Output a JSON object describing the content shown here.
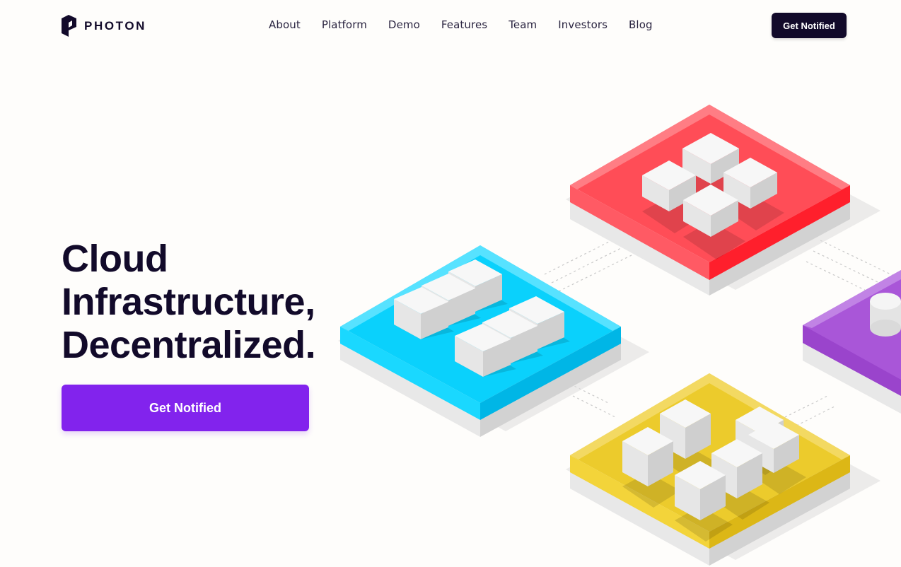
{
  "brand": {
    "name": "PHOTON",
    "icon": "photon-logo-icon"
  },
  "nav": {
    "items": [
      {
        "label": "About"
      },
      {
        "label": "Platform"
      },
      {
        "label": "Demo"
      },
      {
        "label": "Features"
      },
      {
        "label": "Team"
      },
      {
        "label": "Investors"
      },
      {
        "label": "Blog"
      }
    ],
    "cta_label": "Get Notified"
  },
  "hero": {
    "headline_lines": [
      "Cloud",
      "Infrastructure,",
      "Decentralized."
    ],
    "cta_label": "Get Notified"
  },
  "colors": {
    "ink": "#120a2a",
    "accent": "#8223ed",
    "tile_red": "#ff4d57",
    "tile_blue": "#0ad1fc",
    "tile_yellow": "#eccb2c",
    "tile_purple": "#a956d8"
  }
}
